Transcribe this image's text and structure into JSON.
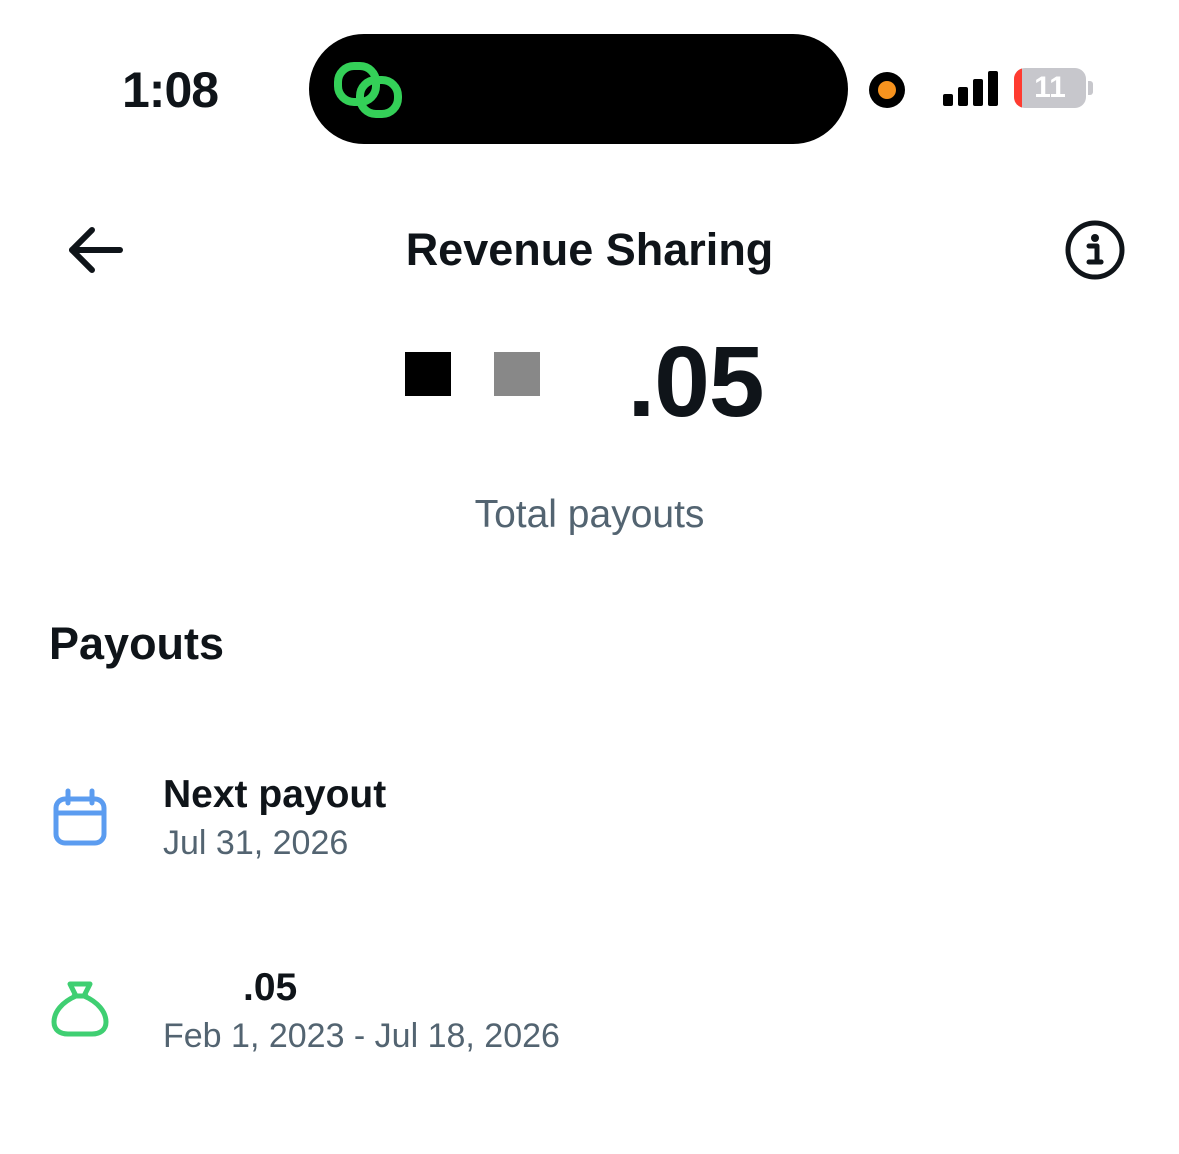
{
  "status_bar": {
    "time": "1:08",
    "battery_level": "11",
    "battery_fraction": 0.11,
    "icons": [
      "linked-rings-icon",
      "recording-dot-icon",
      "signal-bars-icon",
      "battery-icon"
    ],
    "colors": {
      "link_icon": "#34d058",
      "recording_dot": "#f7931e",
      "battery_low": "#ff3b30"
    }
  },
  "header": {
    "title": "Revenue Sharing",
    "back_icon": "arrow-left-icon",
    "info_icon": "info-circle-icon"
  },
  "summary": {
    "total_amount_visible": ".05",
    "total_label": "Total payouts"
  },
  "payouts": {
    "heading": "Payouts",
    "items": [
      {
        "icon": "calendar-icon",
        "icon_color": "#5b9cf0",
        "title": "Next payout",
        "subtitle": "Jul 31, 2026"
      },
      {
        "icon": "money-bag-icon",
        "icon_color": "#3fcf72",
        "title": ".05",
        "subtitle": "Feb 1, 2023 - Jul 18, 2026"
      }
    ]
  },
  "colors": {
    "text_primary": "#0f1419",
    "text_secondary": "#536471",
    "background": "#ffffff"
  }
}
